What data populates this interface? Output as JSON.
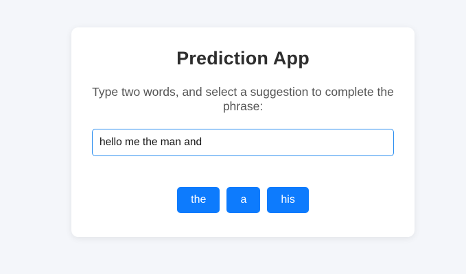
{
  "app": {
    "title": "Prediction App",
    "instructions": "Type two words, and select a suggestion to complete the phrase:"
  },
  "input": {
    "value": "hello me the man and",
    "focused": true
  },
  "suggestions": [
    {
      "label": "the"
    },
    {
      "label": "a"
    },
    {
      "label": "his"
    }
  ],
  "colors": {
    "page_background": "#f4f6fa",
    "card_background": "#ffffff",
    "accent": "#0d7bfd",
    "input_border_focus": "#2d8ff0",
    "title_text": "#2e2e2e",
    "subtitle_text": "#555555"
  }
}
